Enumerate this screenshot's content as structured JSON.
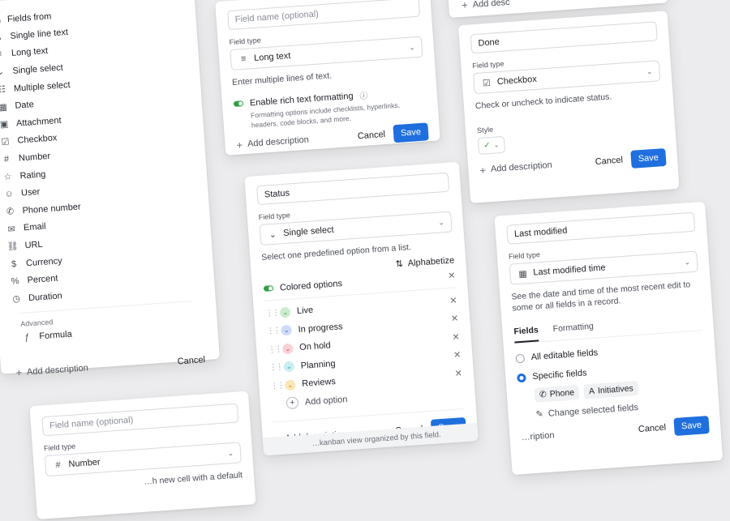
{
  "fields_list": {
    "header": "Fields from",
    "items": [
      {
        "icon": "A",
        "label": "Single line text"
      },
      {
        "icon": "≡",
        "label": "Long text"
      },
      {
        "icon": "⌄",
        "label": "Single select"
      },
      {
        "icon": "☷",
        "label": "Multiple select"
      },
      {
        "icon": "▦",
        "label": "Date"
      },
      {
        "icon": "▣",
        "label": "Attachment"
      },
      {
        "icon": "☑",
        "label": "Checkbox"
      },
      {
        "icon": "#",
        "label": "Number"
      },
      {
        "icon": "☆",
        "label": "Rating"
      },
      {
        "icon": "☺",
        "label": "User"
      },
      {
        "icon": "✆",
        "label": "Phone number"
      },
      {
        "icon": "✉",
        "label": "Email"
      },
      {
        "icon": "⛓",
        "label": "URL"
      },
      {
        "icon": "$",
        "label": "Currency"
      },
      {
        "icon": "%",
        "label": "Percent"
      },
      {
        "icon": "◷",
        "label": "Duration"
      }
    ],
    "advanced_label": "Advanced",
    "advanced_items": [
      {
        "icon": "ƒ",
        "label": "Formula"
      }
    ],
    "add_description": "Add description",
    "cancel": "Cancel"
  },
  "number_card": {
    "name_placeholder": "Field name (optional)",
    "field_type_label": "Field type",
    "field_type": "Number",
    "desc": "…h new cell with a default"
  },
  "long_text_card": {
    "name_placeholder": "Field name (optional)",
    "field_type_label": "Field type",
    "field_type": "Long text",
    "desc": "Enter multiple lines of text.",
    "rich_label": "Enable rich text formatting",
    "rich_help": "Formatting options include checklists, hyperlinks, headers, code blocks, and more.",
    "add_description": "Add description",
    "cancel": "Cancel",
    "save": "Save"
  },
  "status_card": {
    "name": "Status",
    "field_type_label": "Field type",
    "field_type": "Single select",
    "desc": "Select one predefined option from a list.",
    "alphabetize": "Alphabetize",
    "colored_options": "Colored options",
    "options": [
      {
        "label": "Live",
        "color": "#cdeccf",
        "fg": "#2f9e44"
      },
      {
        "label": "In progress",
        "color": "#cfdcf8",
        "fg": "#2f5fc4"
      },
      {
        "label": "On hold",
        "color": "#f9d2d8",
        "fg": "#c43b55"
      },
      {
        "label": "Planning",
        "color": "#c9eef2",
        "fg": "#1d8c9a"
      },
      {
        "label": "Reviews",
        "color": "#fbe7b6",
        "fg": "#b4830c"
      }
    ],
    "add_option": "Add option",
    "add_description": "Add description",
    "cancel": "Cancel",
    "save": "Save",
    "footer_note": "…kanban view organized by this field."
  },
  "top_right_card": {
    "add_description": "Add desc"
  },
  "checkbox_card": {
    "name": "Done",
    "field_type_label": "Field type",
    "field_type": "Checkbox",
    "desc": "Check or uncheck to indicate status.",
    "style_label": "Style",
    "add_description": "Add description",
    "cancel": "Cancel",
    "save": "Save"
  },
  "modified_card": {
    "name": "Last modified",
    "field_type_label": "Field type",
    "field_type": "Last modified time",
    "desc": "See the date and time of the most recent edit to some or all fields in a record.",
    "tabs": [
      "Fields",
      "Formatting"
    ],
    "radio_all": "All editable fields",
    "radio_specific": "Specific fields",
    "chips": [
      {
        "icon": "✆",
        "label": "Phone"
      },
      {
        "icon": "A",
        "label": "Initiatives"
      }
    ],
    "change": "Change selected fields",
    "add_description": "…ription",
    "cancel": "Cancel",
    "save": "Save"
  }
}
